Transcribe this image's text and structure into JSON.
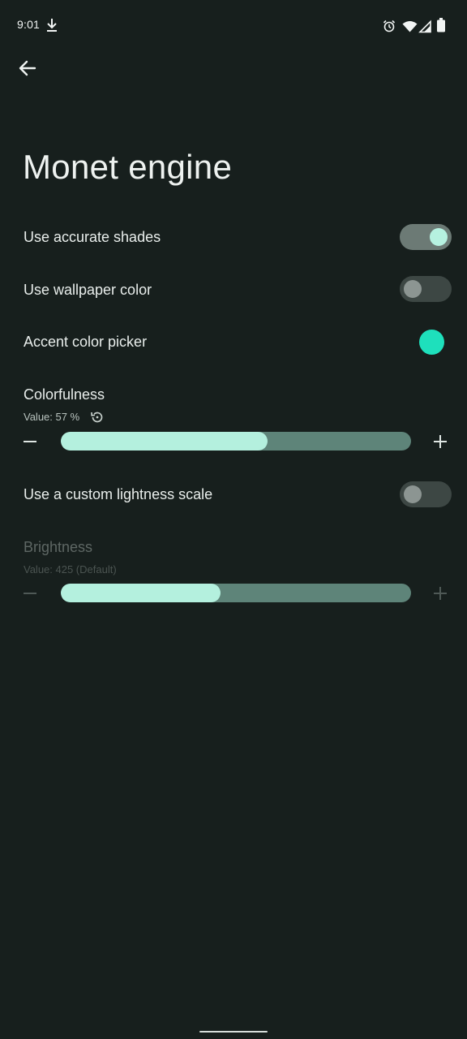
{
  "status_bar": {
    "time": "9:01",
    "icons": [
      "download-icon",
      "alarm-icon",
      "wifi-icon",
      "signal-icon",
      "battery-icon"
    ]
  },
  "app_bar": {
    "back_icon": "arrow-left-icon"
  },
  "page": {
    "title": "Monet engine"
  },
  "settings": {
    "accurate_shades": {
      "label": "Use accurate shades",
      "enabled": true
    },
    "wallpaper_color": {
      "label": "Use wallpaper color",
      "enabled": false
    },
    "accent_picker": {
      "label": "Accent color picker",
      "color": "#1ee0bc"
    },
    "colorfulness": {
      "label": "Colorfulness",
      "value_text": "Value: 57 %",
      "reset_icon": "reset-icon",
      "fraction": 0.59,
      "minus": "−",
      "plus": "+"
    },
    "custom_lightness": {
      "label": "Use a custom lightness scale",
      "enabled": false
    },
    "brightness": {
      "label": "Brightness",
      "value_text": "Value: 425 (Default)",
      "fraction": 0.455,
      "minus": "−",
      "plus": "+",
      "disabled": true
    }
  },
  "colors": {
    "background": "#171f1d",
    "accent": "#1ee0bc",
    "slider_active": "#b4f0de",
    "slider_inactive": "#5e8479"
  }
}
